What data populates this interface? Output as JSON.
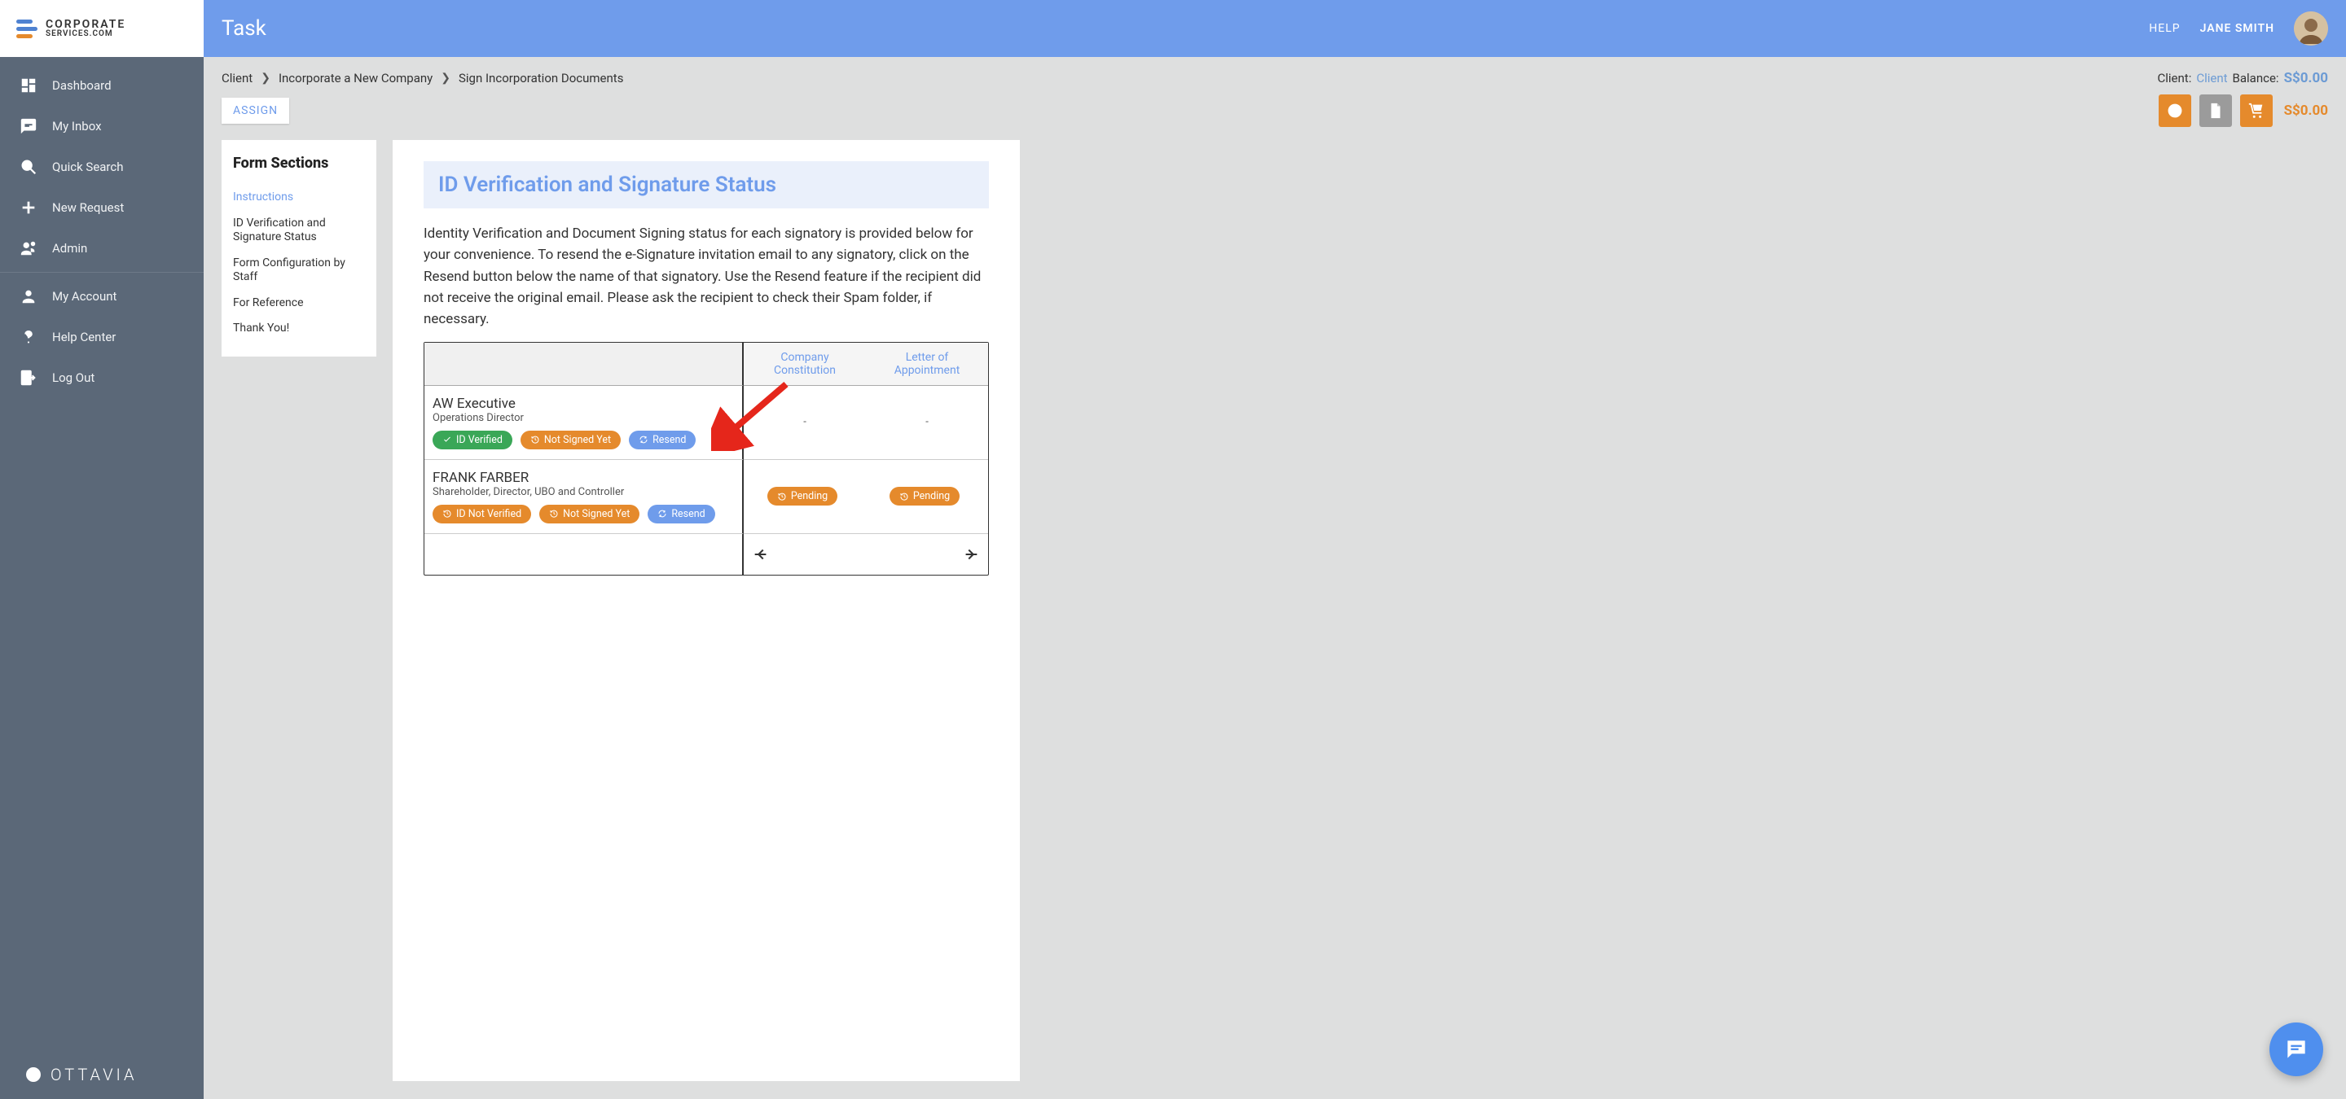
{
  "brand": {
    "name": "CORPORATE",
    "sub": "SERVICES.COM"
  },
  "topbar": {
    "title": "Task",
    "help": "HELP",
    "user": "JANE SMITH"
  },
  "sidebar": {
    "items": [
      {
        "label": "Dashboard"
      },
      {
        "label": "My Inbox"
      },
      {
        "label": "Quick Search"
      },
      {
        "label": "New Request"
      },
      {
        "label": "Admin"
      },
      {
        "label": "My Account"
      },
      {
        "label": "Help Center"
      },
      {
        "label": "Log Out"
      }
    ],
    "footer": "OTTAVIA"
  },
  "breadcrumb": {
    "a": "Client",
    "b": "Incorporate a New Company",
    "c": "Sign Incorporation Documents",
    "right": {
      "client_label": "Client:",
      "client_link": "Client",
      "balance_label": "Balance:",
      "balance": "S$0.00"
    }
  },
  "actions": {
    "assign": "ASSIGN",
    "cart_total": "S$0.00"
  },
  "formSections": {
    "title": "Form Sections",
    "items": [
      "Instructions",
      "ID Verification and Signature Status",
      "Form Configuration by Staff",
      "For Reference",
      "Thank You!"
    ],
    "activeIndex": 0
  },
  "section": {
    "heading": "ID Verification and Signature Status",
    "body": "Identity Verification and Document Signing status for each signatory is provided below for your convenience. To resend the e-Signature invitation email to any signatory, click on the Resend button below the name of that signatory. Use the Resend feature if the recipient did not receive the original email. Please ask the recipient to check their Spam folder, if necessary."
  },
  "table": {
    "headers": {
      "col1": "",
      "col2": "Company Constitution",
      "col3": "Letter of Appointment"
    },
    "rows": [
      {
        "name": "AW Executive",
        "role": "Operations Director",
        "pills": {
          "verify": "ID Verified",
          "verify_kind": "green",
          "sign": "Not Signed Yet",
          "resend": "Resend"
        },
        "c2": "-",
        "c3": "-"
      },
      {
        "name": "FRANK FARBER",
        "role": "Shareholder, Director, UBO and Controller",
        "pills": {
          "verify": "ID Not Verified",
          "verify_kind": "orange",
          "sign": "Not Signed Yet",
          "resend": "Resend"
        },
        "c2": "Pending",
        "c3": "Pending"
      }
    ]
  }
}
